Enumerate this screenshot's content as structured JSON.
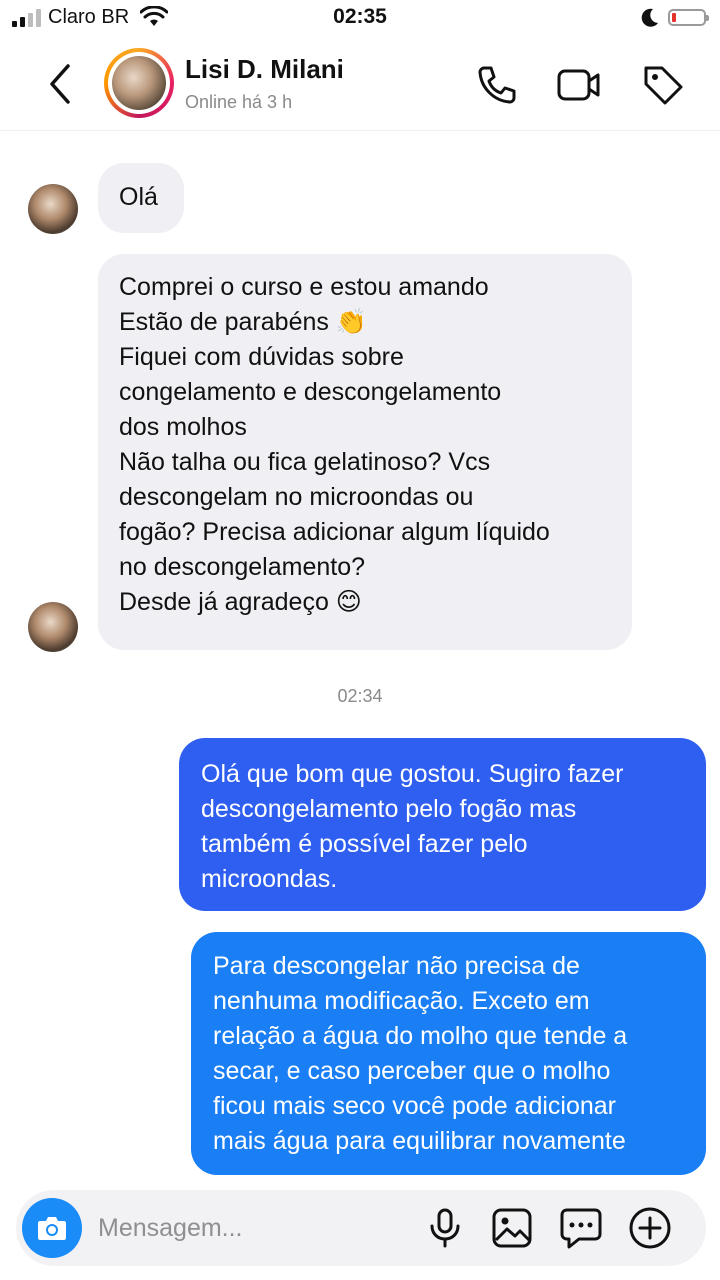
{
  "status_bar": {
    "carrier": "Claro BR",
    "time": "02:35"
  },
  "header": {
    "contact_name": "Lisi D. Milani",
    "contact_status": "Online há 3 h",
    "icons": [
      "back-chevron-icon",
      "phone-icon",
      "video-camera-icon",
      "tag-icon"
    ]
  },
  "messages": {
    "incoming_1": "Olá",
    "incoming_2_lines": [
      "Comprei o curso e estou amando",
      "Estão de parabéns 👏",
      "Fiquei com dúvidas sobre",
      "congelamento e descongelamento",
      "dos molhos",
      "Não talha ou fica gelatinoso? Vcs",
      "descongelam no microondas ou",
      "fogão? Precisa adicionar algum líquido",
      "no descongelamento?",
      "Desde já agradeço 😊"
    ],
    "timestamp": "02:34",
    "outgoing_1_lines": [
      "Olá que bom que gostou. Sugiro fazer",
      "descongelamento pelo fogão mas",
      "também é possível fazer pelo",
      "microondas."
    ],
    "outgoing_2_lines": [
      "Para descongelar não precisa de",
      "nenhuma modificação. Exceto em",
      "relação a água do molho que tende a",
      "secar, e caso perceber que o molho",
      "ficou mais seco você pode adicionar",
      "mais água para equilibrar novamente"
    ]
  },
  "composer": {
    "placeholder": "Mensagem...",
    "icons": [
      "camera-icon",
      "microphone-icon",
      "gallery-icon",
      "sticker-chat-icon",
      "plus-circle-icon"
    ]
  },
  "colors": {
    "incoming_bubble": "#efeff4",
    "outgoing_1_bubble": "#2f5ff0",
    "outgoing_2_bubble": "#1a7ef5",
    "camera_button": "#1a8cf7"
  }
}
